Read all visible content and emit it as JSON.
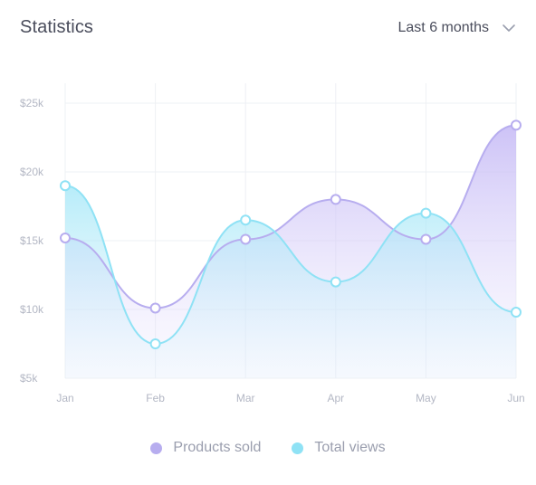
{
  "header": {
    "title": "Statistics",
    "period": "Last 6 months",
    "chevron_icon": "chevron-down-icon"
  },
  "colors": {
    "products": "#b7adef",
    "views": "#8fe2f5",
    "products_fill": "#d7cffa",
    "views_fill": "#cfeefc",
    "grid": "#eef0f4",
    "tick": "#b3b7c4"
  },
  "chart_data": {
    "type": "area",
    "categories": [
      "Jan",
      "Feb",
      "Mar",
      "Apr",
      "May",
      "Jun"
    ],
    "series": [
      {
        "name": "Products sold",
        "values": [
          15200,
          10100,
          15100,
          18000,
          15100,
          23400
        ]
      },
      {
        "name": "Total views",
        "values": [
          19000,
          7500,
          16500,
          12000,
          17000,
          9800
        ]
      }
    ],
    "yticks": [
      5000,
      10000,
      15000,
      20000,
      25000
    ],
    "ytick_labels": [
      "$5k",
      "$10k",
      "$15k",
      "$20k",
      "$25k"
    ],
    "ylim": [
      5000,
      25000
    ],
    "grid": true,
    "legend_position": "bottom-center",
    "smooth": true
  }
}
